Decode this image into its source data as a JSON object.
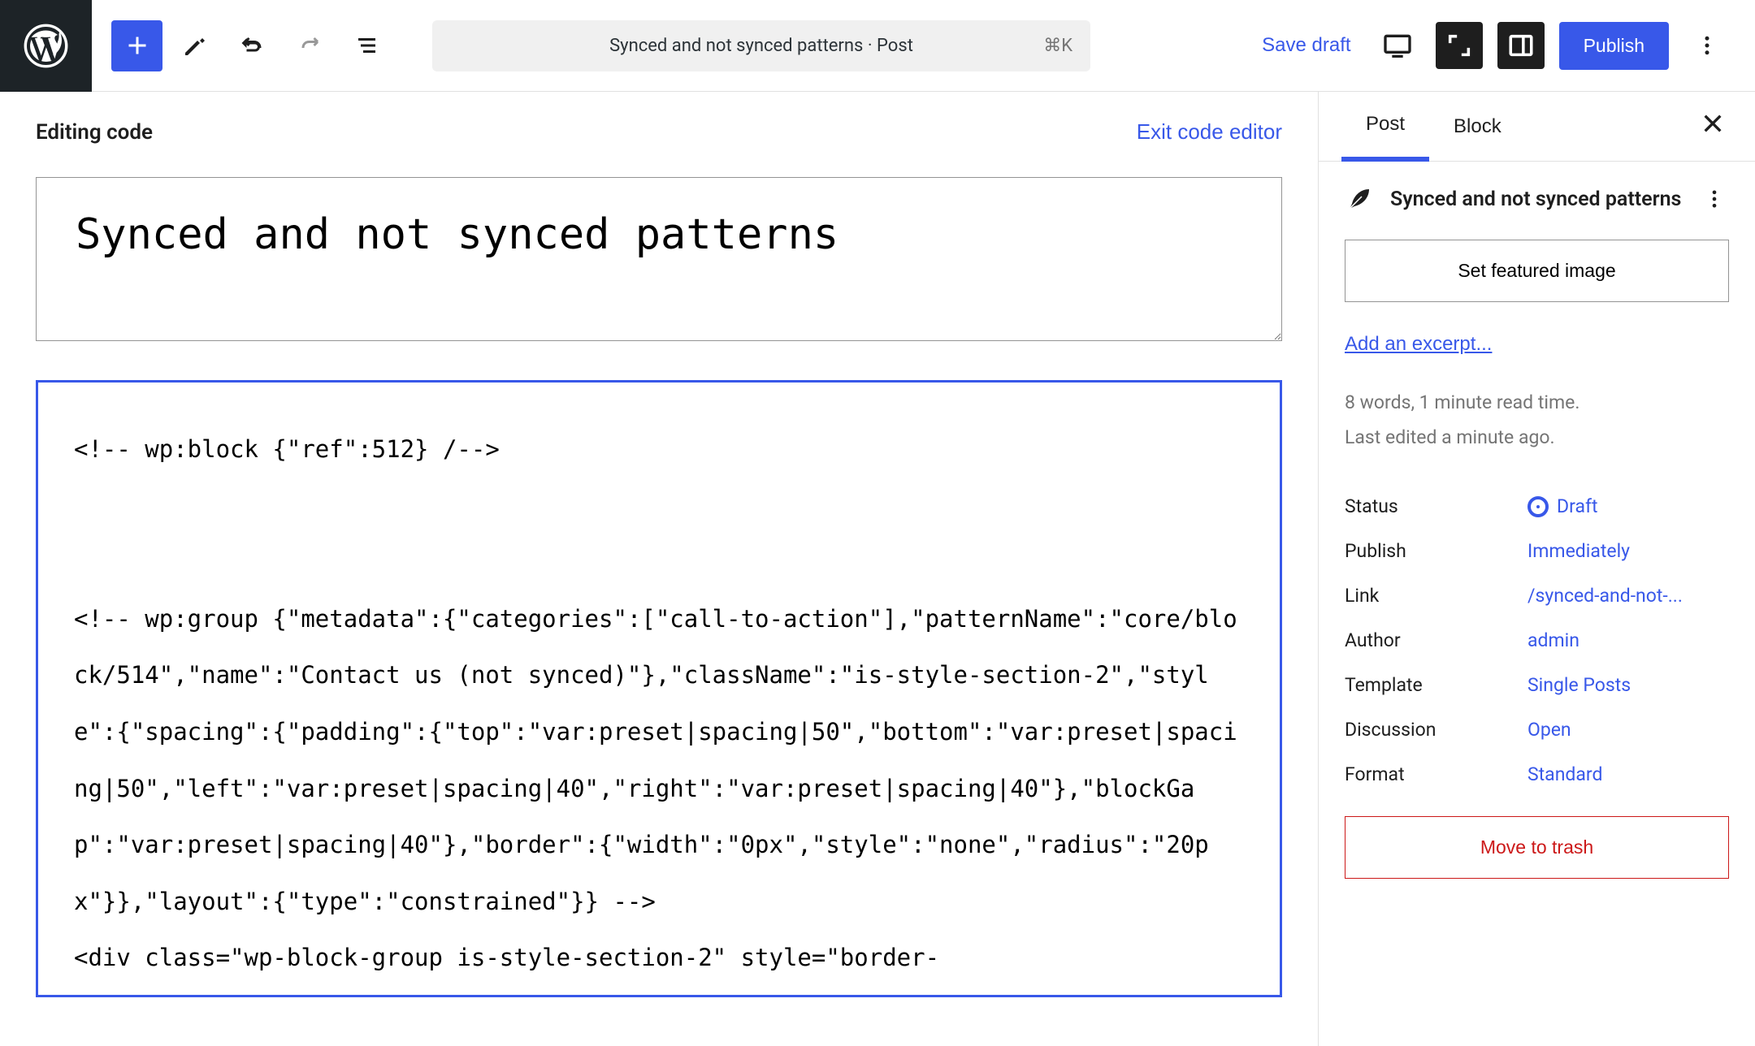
{
  "topbar": {
    "document_title": "Synced and not synced patterns · Post",
    "kbd": "⌘K",
    "save_draft": "Save draft",
    "publish": "Publish"
  },
  "editor": {
    "header_label": "Editing code",
    "exit_link": "Exit code editor",
    "title_value": "Synced and not synced patterns",
    "code_value": "<!-- wp:block {\"ref\":512} /-->\n\n\n<!-- wp:group {\"metadata\":{\"categories\":[\"call-to-action\"],\"patternName\":\"core/block/514\",\"name\":\"Contact us (not synced)\"},\"className\":\"is-style-section-2\",\"style\":{\"spacing\":{\"padding\":{\"top\":\"var:preset|spacing|50\",\"bottom\":\"var:preset|spacing|50\",\"left\":\"var:preset|spacing|40\",\"right\":\"var:preset|spacing|40\"},\"blockGap\":\"var:preset|spacing|40\"},\"border\":{\"width\":\"0px\",\"style\":\"none\",\"radius\":\"20px\"}},\"layout\":{\"type\":\"constrained\"}} -->\n<div class=\"wp-block-group is-style-section-2\" style=\"border-"
  },
  "sidebar": {
    "tabs": {
      "post": "Post",
      "block": "Block"
    },
    "post_title": "Synced and not synced patterns",
    "featured_image": "Set featured image",
    "excerpt_link": "Add an excerpt...",
    "meta_words": "8 words, 1 minute read time.",
    "meta_edited": "Last edited a minute ago.",
    "rows": {
      "status": {
        "label": "Status",
        "value": "Draft"
      },
      "publish": {
        "label": "Publish",
        "value": "Immediately"
      },
      "link": {
        "label": "Link",
        "value": "/synced-and-not-..."
      },
      "author": {
        "label": "Author",
        "value": "admin"
      },
      "template": {
        "label": "Template",
        "value": "Single Posts"
      },
      "discussion": {
        "label": "Discussion",
        "value": "Open"
      },
      "format": {
        "label": "Format",
        "value": "Standard"
      }
    },
    "trash": "Move to trash"
  }
}
